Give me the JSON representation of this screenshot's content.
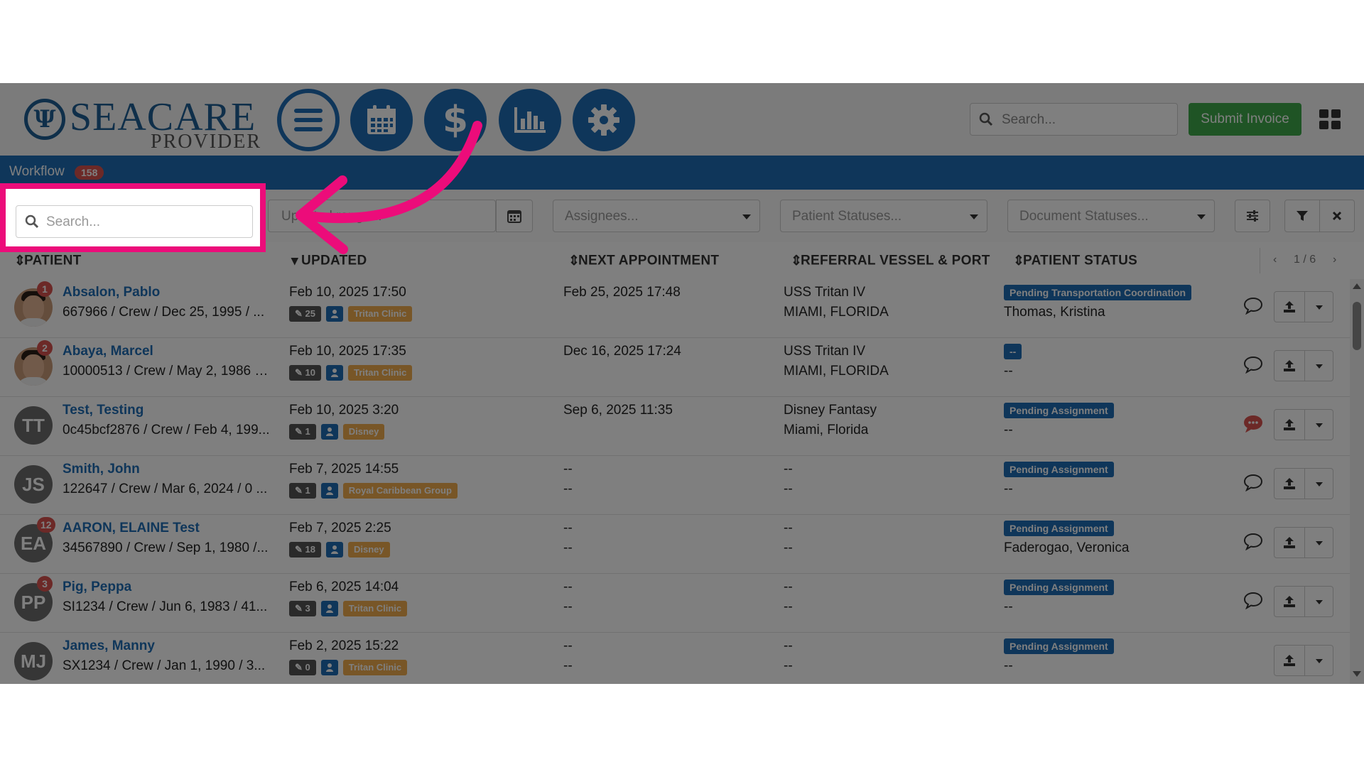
{
  "brand": {
    "name_main": "SEACARE",
    "name_sub": "PROVIDER"
  },
  "nav": [
    "menu-icon",
    "calendar-icon",
    "dollar-icon",
    "bar-chart-icon",
    "gear-icon"
  ],
  "header": {
    "search_placeholder": "Search...",
    "submit_invoice_label": "Submit Invoice"
  },
  "workflow": {
    "label": "Workflow",
    "count": "158"
  },
  "filters": {
    "search_placeholder": "Search...",
    "updated_range_placeholder": "Updated range...",
    "assignees_placeholder": "Assignees...",
    "patient_statuses_placeholder": "Patient Statuses...",
    "document_statuses_placeholder": "Document Statuses..."
  },
  "columns": {
    "patient": "PATIENT",
    "updated": "UPDATED",
    "next_appointment": "NEXT APPOINTMENT",
    "referral": "REFERRAL VESSEL & PORT",
    "status": "PATIENT STATUS"
  },
  "pager": {
    "text": "1 / 6",
    "prev": "‹",
    "next": "›"
  },
  "rows": [
    {
      "initials": "",
      "badge": "1",
      "name": "Absalon, Pablo",
      "detail": "667966 / Crew / Dec 25, 1995 / ...",
      "updated": "Feb 10, 2025 17:50",
      "doc_count": "25",
      "org": "Tritan Clinic",
      "next_appointment": "Feb 25, 2025 17:48",
      "next_appointment_2": "",
      "vessel": "USS Tritan IV",
      "port": "MIAMI, FLORIDA",
      "status": "Pending Transportation Coordination",
      "assignee": "Thomas, Kristina",
      "chat_alert": false,
      "chat": true
    },
    {
      "initials": "",
      "badge": "2",
      "name": "Abaya, Marcel",
      "detail": "10000513 / Crew / May 2, 1986 / ...",
      "updated": "Feb 10, 2025 17:35",
      "doc_count": "10",
      "org": "Tritan Clinic",
      "next_appointment": "Dec 16, 2025 17:24",
      "next_appointment_2": "",
      "vessel": "USS Tritan IV",
      "port": "MIAMI, FLORIDA",
      "status": "--",
      "assignee": "--",
      "chat_alert": false,
      "chat": true
    },
    {
      "initials": "TT",
      "badge": "",
      "name": "Test, Testing",
      "detail": "0c45bcf2876 / Crew / Feb 4, 199...",
      "updated": "Feb 10, 2025 3:20",
      "doc_count": "1",
      "org": "Disney",
      "next_appointment": "Sep 6, 2025 11:35",
      "next_appointment_2": "",
      "vessel": "Disney Fantasy",
      "port": "Miami, Florida",
      "status": "Pending Assignment",
      "assignee": "--",
      "chat_alert": true,
      "chat": true
    },
    {
      "initials": "JS",
      "badge": "",
      "name": "Smith, John",
      "detail": "122647 / Crew / Mar 6, 2024 / 0 ...",
      "updated": "Feb 7, 2025 14:55",
      "doc_count": "1",
      "org": "Royal Caribbean Group",
      "next_appointment": "--",
      "next_appointment_2": "--",
      "vessel": "--",
      "port": "--",
      "status": "Pending Assignment",
      "assignee": "--",
      "chat_alert": false,
      "chat": true
    },
    {
      "initials": "EA",
      "badge": "12",
      "name": "AARON, ELAINE Test",
      "detail": "34567890 / Crew / Sep 1, 1980 /...",
      "updated": "Feb 7, 2025 2:25",
      "doc_count": "18",
      "org": "Disney",
      "next_appointment": "--",
      "next_appointment_2": "--",
      "vessel": "--",
      "port": "--",
      "status": "Pending Assignment",
      "assignee": "Faderogao, Veronica",
      "chat_alert": false,
      "chat": true
    },
    {
      "initials": "PP",
      "badge": "3",
      "name": "Pig, Peppa",
      "detail": "SI1234 / Crew / Jun 6, 1983 / 41...",
      "updated": "Feb 6, 2025 14:04",
      "doc_count": "3",
      "org": "Tritan Clinic",
      "next_appointment": "--",
      "next_appointment_2": "--",
      "vessel": "--",
      "port": "--",
      "status": "Pending Assignment",
      "assignee": "--",
      "chat_alert": false,
      "chat": true
    },
    {
      "initials": "MJ",
      "badge": "",
      "name": "James, Manny",
      "detail": "SX1234 / Crew / Jan 1, 1990 / 3...",
      "updated": "Feb 2, 2025 15:22",
      "doc_count": "0",
      "org": "Tritan Clinic",
      "next_appointment": "--",
      "next_appointment_2": "--",
      "vessel": "--",
      "port": "--",
      "status": "Pending Assignment",
      "assignee": "--",
      "chat_alert": false,
      "chat": false
    }
  ],
  "colors": {
    "brand_blue": "#1f6db5",
    "highlight_pink": "#ec0c7a",
    "success_green": "#3fa94b",
    "badge_red": "#d9534f",
    "org_orange": "#f0ad4e"
  }
}
